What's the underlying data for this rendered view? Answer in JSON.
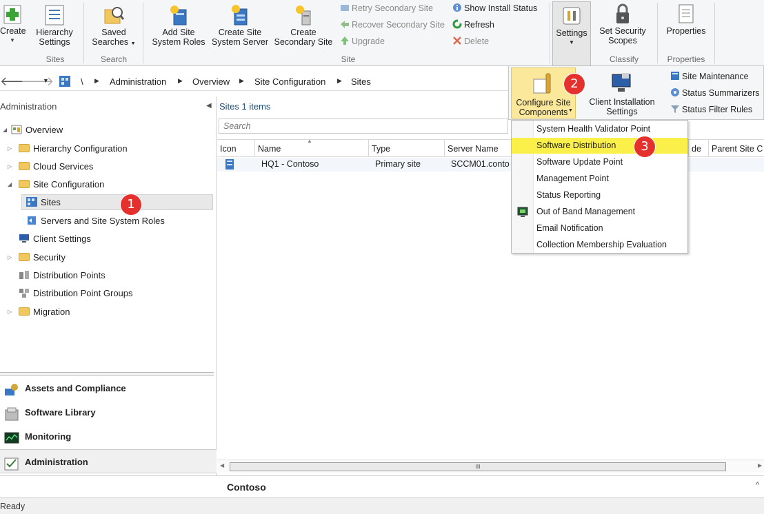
{
  "ribbon": {
    "create_label": "Create",
    "hierarchy_settings_label": "Hierarchy Settings",
    "saved_searches_label": "Saved Searches",
    "add_site_system_roles_label": "Add Site System Roles",
    "create_site_system_server_label": "Create Site System Server",
    "create_secondary_site_label": "Create Secondary Site",
    "retry_secondary_site_label": "Retry Secondary Site",
    "recover_secondary_site_label": "Recover Secondary Site",
    "upgrade_label": "Upgrade",
    "show_install_status_label": "Show Install Status",
    "refresh_label": "Refresh",
    "delete_label": "Delete",
    "settings_label": "Settings",
    "set_security_scopes_label": "Set Security Scopes",
    "properties_label": "Properties",
    "groups": {
      "sites": "Sites",
      "search": "Search",
      "site": "Site",
      "classify": "Classify",
      "properties": "Properties"
    }
  },
  "settings_panel": {
    "configure_site_components_label": "Configure Site Components",
    "client_installation_settings_label": "Client Installation Settings",
    "site_maintenance_label": "Site Maintenance",
    "status_summarizers_label": "Status Summarizers",
    "status_filter_rules_label": "Status Filter Rules"
  },
  "address": {
    "root": "\\",
    "crumbs": [
      "Administration",
      "Overview",
      "Site Configuration",
      "Sites"
    ]
  },
  "left": {
    "header": "Administration",
    "tree": {
      "overview": "Overview",
      "hierarchy_configuration": "Hierarchy Configuration",
      "cloud_services": "Cloud Services",
      "site_configuration": "Site Configuration",
      "sites": "Sites",
      "servers_roles": "Servers and Site System Roles",
      "client_settings": "Client Settings",
      "security": "Security",
      "distribution_points": "Distribution Points",
      "distribution_point_groups": "Distribution Point Groups",
      "migration": "Migration"
    },
    "workspaces": {
      "assets": "Assets and Compliance",
      "software_library": "Software Library",
      "monitoring": "Monitoring",
      "administration": "Administration"
    }
  },
  "results": {
    "title": "Sites 1 items",
    "search_placeholder": "Search",
    "columns": [
      "Icon",
      "Name",
      "Type",
      "Server Name",
      "de",
      "Parent Site C"
    ],
    "row": {
      "name": "HQ1 - Contoso",
      "type": "Primary site",
      "server": "SCCM01.conto"
    }
  },
  "dropdown": {
    "items": [
      "System Health Validator Point",
      "Software Distribution",
      "Software Update Point",
      "Management Point",
      "Status Reporting",
      "Out of Band Management",
      "Email Notification",
      "Collection Membership Evaluation"
    ],
    "highlight_color": "#fbef4a"
  },
  "details": {
    "title": "Contoso"
  },
  "status": {
    "text": "Ready"
  },
  "badges": {
    "one": "1",
    "two": "2",
    "three": "3",
    "color": "#e4312d"
  },
  "scrollbar": {
    "thumb_glyph": "III"
  }
}
